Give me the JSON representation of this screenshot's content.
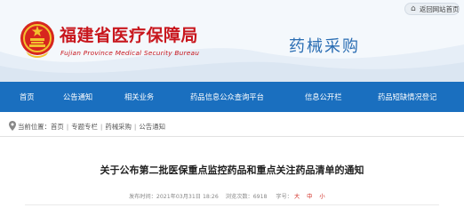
{
  "header": {
    "org_name_cn": "福建省医疗保障局",
    "org_name_en": "Fujian Province Medical Security Bureau",
    "section_title": "药械采购",
    "back_button": "返回网站首页",
    "back_icon": "⌂"
  },
  "nav": {
    "items": [
      {
        "label": "首页"
      },
      {
        "label": "公告通知"
      },
      {
        "label": "相关业务"
      },
      {
        "label": "药品信息公众查询平台"
      },
      {
        "label": "信息公开栏"
      },
      {
        "label": "药品短缺情况登记"
      }
    ]
  },
  "breadcrumb": {
    "prefix": "当前位置：",
    "items": [
      "首页",
      "专题专栏",
      "药械采购",
      "公告通知"
    ],
    "separator": "|"
  },
  "article": {
    "title": "关于公布第二批医保重点监控药品和重点关注药品清单的通知",
    "meta_published": "发布时间：2021年03月31日 18:26",
    "meta_views": "浏览次数：6918",
    "font_label": "字号：",
    "font_large": "大",
    "font_medium": "中",
    "font_small": "小"
  },
  "colors": {
    "brand_red": "#c8161d",
    "nav_blue": "#1a6fbf",
    "section_blue": "#2a6db3"
  }
}
